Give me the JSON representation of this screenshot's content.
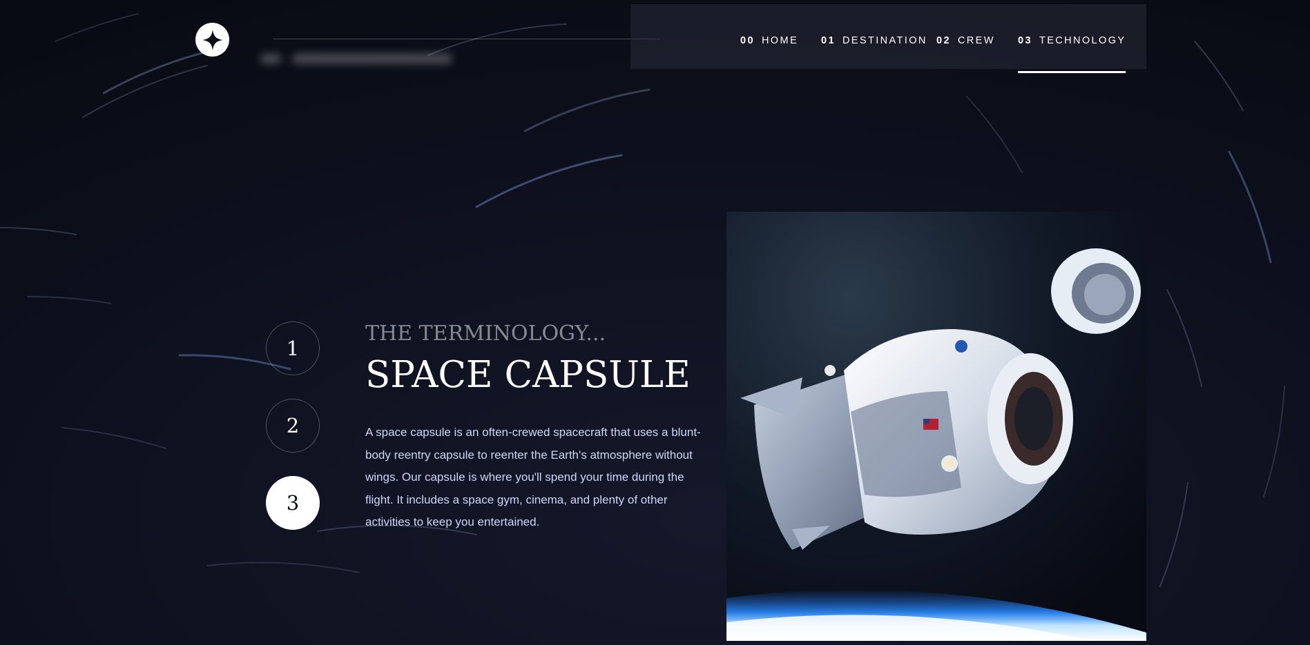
{
  "header": {
    "logo_icon": "star-icon"
  },
  "nav": {
    "items": [
      {
        "num": "00",
        "label": "HOME",
        "active": false
      },
      {
        "num": "01",
        "label": "DESTINATION",
        "active": false
      },
      {
        "num": "02",
        "label": "CREW",
        "active": false
      },
      {
        "num": "03",
        "label": "TECHNOLOGY",
        "active": true
      }
    ]
  },
  "steps": [
    {
      "label": "1",
      "active": false
    },
    {
      "label": "2",
      "active": false
    },
    {
      "label": "3",
      "active": true
    }
  ],
  "content": {
    "eyebrow": "THE TERMINOLOGY...",
    "title": "SPACE CAPSULE",
    "description": "A space capsule is an often-crewed spacecraft that uses a blunt-body reentry capsule to reenter the Earth's atmosphere without wings. Our capsule is where you'll spend your time during the flight. It includes a space gym, cinema, and plenty of other activities to keep you entertained."
  },
  "image": {
    "subject": "space-capsule-image"
  },
  "colors": {
    "background": "#0b0d17",
    "accent_text": "#d0d6f9",
    "white": "#ffffff"
  }
}
